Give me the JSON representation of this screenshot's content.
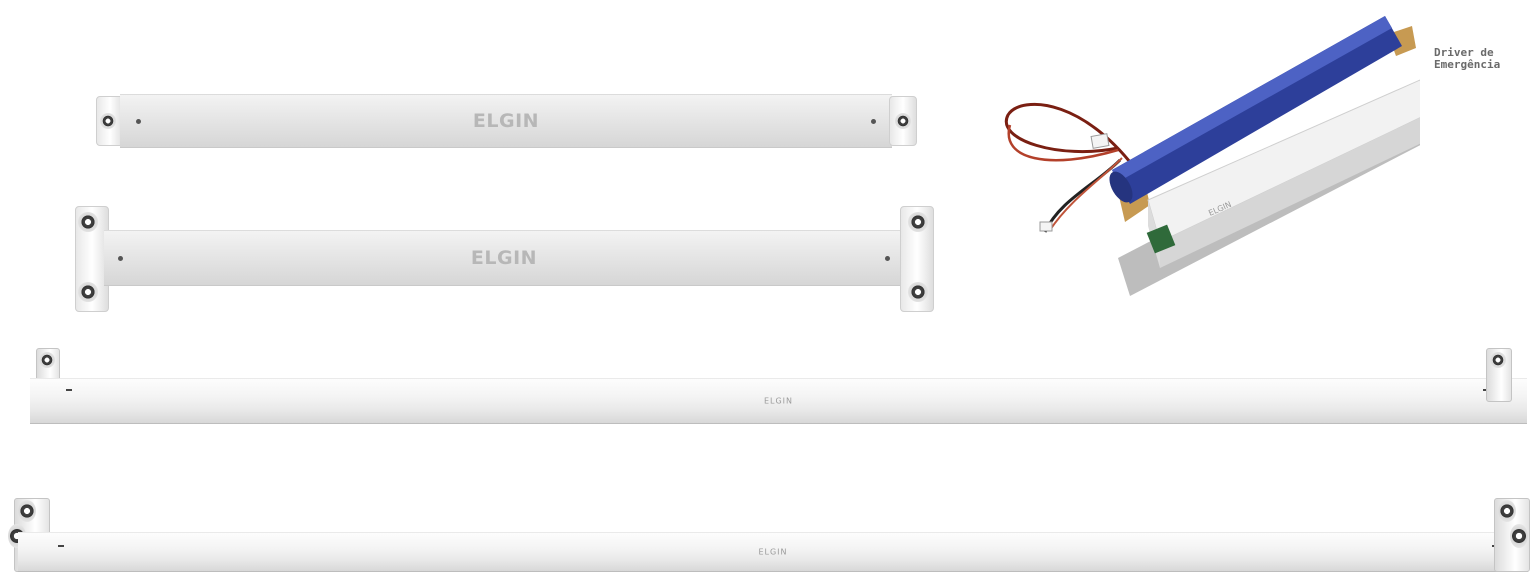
{
  "fixtures": {
    "short_single_brand": "ELGIN",
    "short_double_brand": "ELGIN",
    "long_single_brand": "ELGIN",
    "long_double_brand": "ELGIN"
  },
  "emergency_driver": {
    "label_line1": "Driver de",
    "label_line2": "Emergência"
  }
}
